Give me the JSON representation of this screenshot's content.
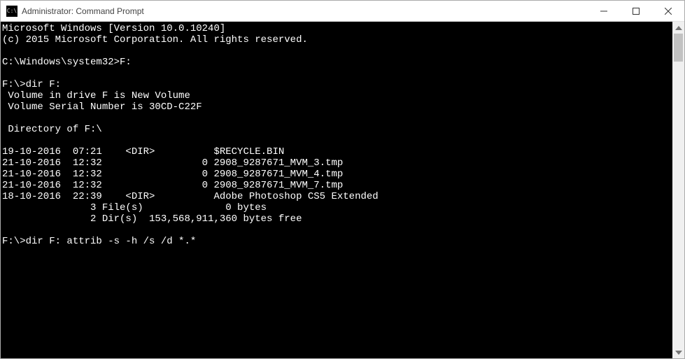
{
  "window": {
    "title": "Administrator: Command Prompt"
  },
  "terminal": {
    "lines": [
      "Microsoft Windows [Version 10.0.10240]",
      "(c) 2015 Microsoft Corporation. All rights reserved.",
      "",
      "C:\\Windows\\system32>F:",
      "",
      "F:\\>dir F:",
      " Volume in drive F is New Volume",
      " Volume Serial Number is 30CD-C22F",
      "",
      " Directory of F:\\",
      "",
      "19-10-2016  07:21    <DIR>          $RECYCLE.BIN",
      "21-10-2016  12:32                 0 2908_9287671_MVM_3.tmp",
      "21-10-2016  12:32                 0 2908_9287671_MVM_4.tmp",
      "21-10-2016  12:32                 0 2908_9287671_MVM_7.tmp",
      "18-10-2016  22:39    <DIR>          Adobe Photoshop CS5 Extended",
      "               3 File(s)              0 bytes",
      "               2 Dir(s)  153,568,911,360 bytes free",
      "",
      "F:\\>dir F: attrib -s -h /s /d *.*"
    ]
  }
}
